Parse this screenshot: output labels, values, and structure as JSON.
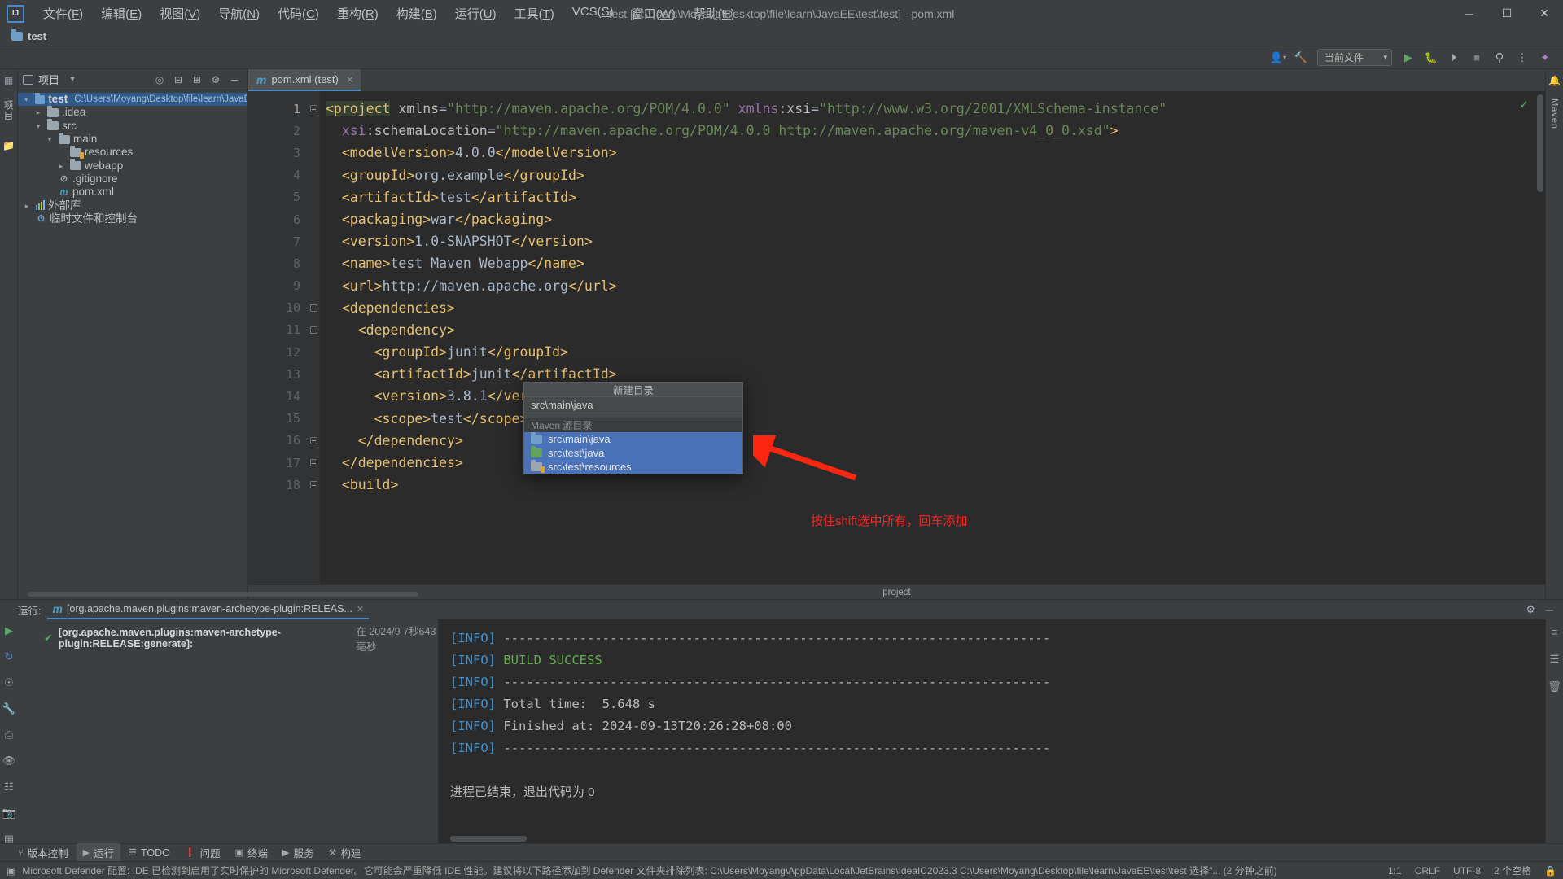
{
  "window": {
    "title": "test [C:\\Users\\Moyang\\Desktop\\file\\learn\\JavaEE\\test\\test] - pom.xml",
    "minimize": "─",
    "maximize": "☐",
    "close": "✕",
    "logo": "IJ"
  },
  "menu": [
    {
      "label": "文件(F)"
    },
    {
      "label": "编辑(E)"
    },
    {
      "label": "视图(V)"
    },
    {
      "label": "导航(N)"
    },
    {
      "label": "代码(C)"
    },
    {
      "label": "重构(R)"
    },
    {
      "label": "构建(B)"
    },
    {
      "label": "运行(U)"
    },
    {
      "label": "工具(T)"
    },
    {
      "label": "VCS(S)"
    },
    {
      "label": "窗口(W)"
    },
    {
      "label": "帮助(H)"
    }
  ],
  "navbar": {
    "project": "test"
  },
  "toolbar": {
    "run_config": "当前文件",
    "chevron": "▾",
    "profile_icon": "profile-icon",
    "build_icon": "hammer-icon",
    "run_icon": "▶",
    "debug_icon": "debug-icon",
    "coverage_icon": "coverage-icon",
    "stop_icon": "■",
    "search_icon": "⌕",
    "more_icon": "⋮",
    "ai_icon": "ai-icon"
  },
  "left_strip": {
    "label": "项目",
    "bookmark_icon": "bookmark-icon",
    "structure_icon": "structure-icon"
  },
  "project_panel": {
    "title": "项目",
    "dropdown": "▾",
    "actions": [
      "target-icon",
      "expand-icon",
      "collapse-icon",
      "settings-icon",
      "hide-icon"
    ],
    "tree": [
      {
        "indent": 0,
        "twisty": "⌄",
        "icon": "project-folder",
        "label": "test",
        "bold": true,
        "path": "C:\\Users\\Moyang\\Desktop\\file\\learn\\JavaEE\\te",
        "selected": true
      },
      {
        "indent": 1,
        "twisty": "›",
        "icon": "folder",
        "label": ".idea",
        "bold": false,
        "path": "",
        "selected": false
      },
      {
        "indent": 1,
        "twisty": "⌄",
        "icon": "folder",
        "label": "src",
        "bold": false,
        "path": "",
        "selected": false
      },
      {
        "indent": 2,
        "twisty": "⌄",
        "icon": "folder",
        "label": "main",
        "bold": false,
        "path": "",
        "selected": false
      },
      {
        "indent": 3,
        "twisty": "",
        "icon": "resources-folder",
        "label": "resources",
        "bold": false,
        "path": "",
        "selected": false
      },
      {
        "indent": 3,
        "twisty": "›",
        "icon": "folder",
        "label": "webapp",
        "bold": false,
        "path": "",
        "selected": false
      },
      {
        "indent": 2,
        "twisty": "",
        "icon": "gitignore-file",
        "label": ".gitignore",
        "bold": false,
        "path": "",
        "selected": false
      },
      {
        "indent": 2,
        "twisty": "",
        "icon": "maven-file",
        "label": "pom.xml",
        "bold": false,
        "path": "",
        "selected": false
      },
      {
        "indent": 0,
        "twisty": "›",
        "icon": "library-icon",
        "label": "外部库",
        "bold": false,
        "path": "",
        "selected": false
      },
      {
        "indent": 0,
        "twisty": "",
        "icon": "scratch-icon",
        "label": "临时文件和控制台",
        "bold": false,
        "path": "",
        "selected": false
      }
    ]
  },
  "editor": {
    "tab": {
      "label": "pom.xml (test)",
      "icon": "maven-icon",
      "close": "✕"
    },
    "breadcrumb": "project",
    "lines": [
      {
        "n": "1",
        "fold": true
      },
      {
        "n": "2",
        "fold": false
      },
      {
        "n": "3",
        "fold": false
      },
      {
        "n": "4",
        "fold": false
      },
      {
        "n": "5",
        "fold": false
      },
      {
        "n": "6",
        "fold": false
      },
      {
        "n": "7",
        "fold": false
      },
      {
        "n": "8",
        "fold": false
      },
      {
        "n": "9",
        "fold": false
      },
      {
        "n": "10",
        "fold": true
      },
      {
        "n": "11",
        "fold": true
      },
      {
        "n": "12",
        "fold": false
      },
      {
        "n": "13",
        "fold": false
      },
      {
        "n": "14",
        "fold": false
      },
      {
        "n": "15",
        "fold": false
      },
      {
        "n": "16",
        "fold": true
      },
      {
        "n": "17",
        "fold": true
      },
      {
        "n": "18",
        "fold": true
      }
    ],
    "code_text": [
      "<project xmlns=\"http://maven.apache.org/POM/4.0.0\" xmlns:xsi=\"http://www.w3.org/2001/XMLSchema-instance\"",
      "  xsi:schemaLocation=\"http://maven.apache.org/POM/4.0.0 http://maven.apache.org/maven-v4_0_0.xsd\">",
      "  <modelVersion>4.0.0</modelVersion>",
      "  <groupId>org.example</groupId>",
      "  <artifactId>test</artifactId>",
      "  <packaging>war</packaging>",
      "  <version>1.0-SNAPSHOT</version>",
      "  <name>test Maven Webapp</name>",
      "  <url>http://maven.apache.org</url>",
      "  <dependencies>",
      "    <dependency>",
      "      <groupId>junit</groupId>",
      "      <artifactId>junit</artifactId>",
      "      <version>3.8.1</version>",
      "      <scope>test</scope>",
      "    </dependency>",
      "  </dependencies>",
      "  <build>"
    ]
  },
  "popup": {
    "header": "新建目录",
    "input_value": "src\\main\\java",
    "group_label": "Maven 源目录",
    "items": [
      {
        "label": "src\\main\\java",
        "icon": "blue-folder-icon",
        "selected": true
      },
      {
        "label": "src\\test\\java",
        "icon": "green-folder-icon",
        "selected": true
      },
      {
        "label": "src\\test\\resources",
        "icon": "resources-folder-icon",
        "selected": true
      }
    ]
  },
  "annotation": {
    "text": "按住shift选中所有，回车添加",
    "color": "#ff2222"
  },
  "run_panel": {
    "label": "运行:",
    "tab": "[org.apache.maven.plugins:maven-archetype-plugin:RELEAS...",
    "tab_close": "✕",
    "tree_item": {
      "status": "✔",
      "title": "[org.apache.maven.plugins:maven-archetype-plugin:RELEASE:generate]:",
      "time": "在 2024/9 7秒643毫秒"
    },
    "side_icons": [
      "rerun-icon",
      "restart-icon",
      "stop-icon",
      "wrench-icon",
      "thread-icon",
      "eye-icon",
      "print-icon",
      "camera-icon",
      "grid-icon",
      "expand-icon"
    ],
    "rail_icons": [
      "list-icon",
      "filter-icon",
      "trash-icon"
    ],
    "gear_icon": "⚙",
    "minimize_icon": "─",
    "console": [
      {
        "tag": "[INFO]",
        "text": " ------------------------------------------------------------------------",
        "kind": "dash"
      },
      {
        "tag": "[INFO]",
        "text": " BUILD SUCCESS",
        "kind": "success"
      },
      {
        "tag": "[INFO]",
        "text": " ------------------------------------------------------------------------",
        "kind": "dash"
      },
      {
        "tag": "[INFO]",
        "text": " Total time:  5.648 s",
        "kind": "plain"
      },
      {
        "tag": "[INFO]",
        "text": " Finished at: 2024-09-13T20:26:28+08:00",
        "kind": "plain"
      },
      {
        "tag": "[INFO]",
        "text": " ------------------------------------------------------------------------",
        "kind": "dash"
      },
      {
        "tag": "",
        "text": "",
        "kind": "plain"
      },
      {
        "tag": "",
        "text": "进程已结束，退出代码为 0",
        "kind": "cn"
      }
    ]
  },
  "toolwindow_bar": [
    {
      "label": "版本控制",
      "icon": "branch-icon",
      "active": false
    },
    {
      "label": "运行",
      "icon": "▶",
      "active": true
    },
    {
      "label": "TODO",
      "icon": "todo-icon",
      "active": false
    },
    {
      "label": "问题",
      "icon": "warning-icon",
      "active": false
    },
    {
      "label": "终端",
      "icon": "terminal-icon",
      "active": false
    },
    {
      "label": "服务",
      "icon": "services-icon",
      "active": false
    },
    {
      "label": "构建",
      "icon": "build-icon",
      "active": false
    }
  ],
  "statusbar": {
    "icon": "notification-icon",
    "message": "Microsoft Defender 配置: IDE 已检测到启用了实时保护的 Microsoft Defender。它可能会严重降低 IDE 性能。建议将以下路径添加到 Defender 文件夹排除列表: C:\\Users\\Moyang\\AppData\\Local\\JetBrains\\IdeaIC2023.3 C:\\Users\\Moyang\\Desktop\\file\\learn\\JavaEE\\test\\test 选择\"... (2 分钟之前)",
    "caret": "1:1",
    "line_sep": "CRLF",
    "encoding": "UTF-8",
    "indent": "2 个空格",
    "lock_icon": "lock-icon"
  }
}
